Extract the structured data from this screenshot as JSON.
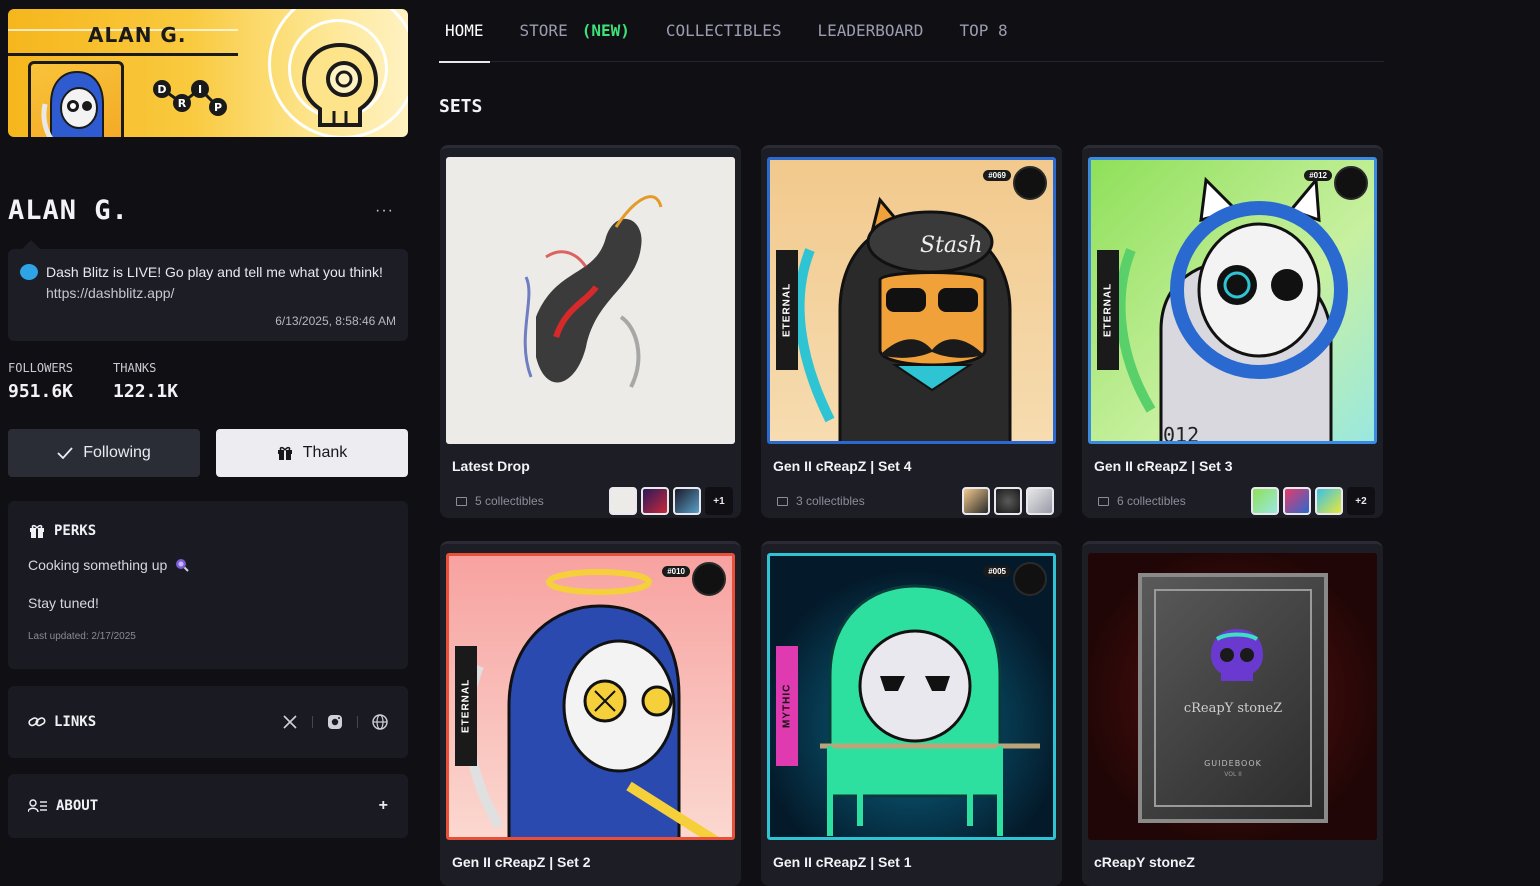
{
  "banner": {
    "name": "ALAN G.",
    "drip_letters": [
      "D",
      "R",
      "I",
      "P"
    ]
  },
  "profile": {
    "name": "ALAN G.",
    "more_label": "···",
    "status_text": "Dash Blitz is LIVE! Go play and tell me what you think!",
    "status_link": "https://dashblitz.app/",
    "status_time": "6/13/2025, 8:58:46 AM"
  },
  "stats": [
    {
      "label": "FOLLOWERS",
      "value": "951.6K"
    },
    {
      "label": "THANKS",
      "value": "122.1K"
    }
  ],
  "buttons": {
    "following": "Following",
    "thank": "Thank"
  },
  "perks": {
    "title": "PERKS",
    "line1": "Cooking something up",
    "line2": "Stay tuned!",
    "updated": "Last updated: 2/17/2025"
  },
  "links": {
    "title": "LINKS"
  },
  "about": {
    "title": "ABOUT",
    "toggle": "+"
  },
  "nav": {
    "tabs": [
      "HOME",
      "STORE",
      "COLLECTIBLES",
      "LEADERBOARD",
      "TOP 8"
    ],
    "store_badge": "(NEW)",
    "active": "HOME"
  },
  "sets_title": "SETS",
  "cards": [
    {
      "title": "Latest Drop",
      "meta": "5 collectibles",
      "more": "+1"
    },
    {
      "title": "Gen II cReapZ | Set 4",
      "meta": "3 collectibles",
      "number": "#069",
      "tier": "ETERNAL",
      "hat_text": "Stash"
    },
    {
      "title": "Gen II cReapZ | Set 3",
      "meta": "6 collectibles",
      "more": "+2",
      "number": "#012",
      "tier": "ETERNAL",
      "suit_text": "012"
    },
    {
      "title": "Gen II cReapZ | Set 2",
      "number": "#010",
      "tier": "ETERNAL"
    },
    {
      "title": "Gen II cReapZ | Set 1",
      "number": "#005",
      "tier": "MYTHIC"
    },
    {
      "title": "cReapY stoneZ",
      "book_title": "cReapY stoneZ",
      "book_sub": "GUIDEBOOK",
      "book_vol": "VOL II"
    }
  ],
  "colors": {
    "accent_new": "#3ee07a",
    "banner_yellow": "#f9c93e",
    "bg": "#0f0f14"
  }
}
